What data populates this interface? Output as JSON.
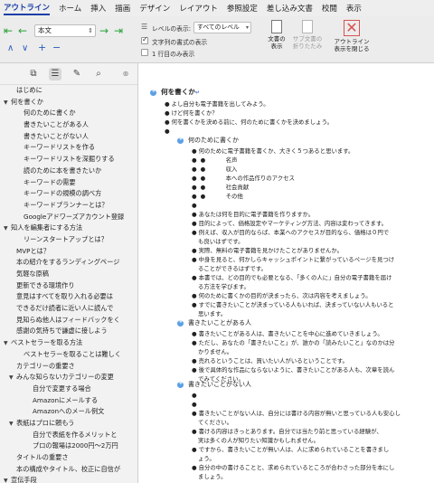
{
  "tabs": [
    "アウトライン",
    "ホーム",
    "挿入",
    "描画",
    "デザイン",
    "レイアウト",
    "参照設定",
    "差し込み文書",
    "校閲",
    "表示"
  ],
  "ribbon": {
    "level_value": "本文",
    "show_level_label": "レベルの表示:",
    "show_level_value": "すべてのレベル",
    "text_format_label": "文字列の書式の表示",
    "first_line_label": "1 行目のみ表示",
    "show_document_label": "文書の\n表示",
    "collapse_subdoc_label": "サブ文書の\n折りたたみ",
    "close_outline_label": "アウトライン\n表示を閉じる"
  },
  "sidebar": {
    "items": [
      {
        "label": "はじめに",
        "indent": 1,
        "tri": ""
      },
      {
        "label": "何を書くか",
        "indent": 0,
        "tri": "▼"
      },
      {
        "label": "何のために書くか",
        "indent": 2,
        "tri": ""
      },
      {
        "label": "書きたいことがある人",
        "indent": 2,
        "tri": ""
      },
      {
        "label": "書きたいことがない人",
        "indent": 2,
        "tri": ""
      },
      {
        "label": "キーワードリストを作る",
        "indent": 2,
        "tri": ""
      },
      {
        "label": "キーワードリストを深掘りする",
        "indent": 2,
        "tri": ""
      },
      {
        "label": "読のために本を書きたいか",
        "indent": 2,
        "tri": ""
      },
      {
        "label": "キーワードの需要",
        "indent": 2,
        "tri": ""
      },
      {
        "label": "キーワードの規模の調べ方",
        "indent": 2,
        "tri": ""
      },
      {
        "label": "キーワードプランナーとは？",
        "indent": 2,
        "tri": ""
      },
      {
        "label": "Googleアドワーズアカウント登録",
        "indent": 2,
        "tri": ""
      },
      {
        "label": "知人を編集者にする方法",
        "indent": 0,
        "tri": "▼"
      },
      {
        "label": "リーンスタートアップとは？",
        "indent": 2,
        "tri": ""
      },
      {
        "label": "MVPとは？",
        "indent": 1,
        "tri": ""
      },
      {
        "label": "本の紹介をするランディングページ",
        "indent": 1,
        "tri": ""
      },
      {
        "label": "気軽な原稿",
        "indent": 1,
        "tri": ""
      },
      {
        "label": "更新できる環境作り",
        "indent": 1,
        "tri": ""
      },
      {
        "label": "意見はすべてを取り入れる必要は",
        "indent": 1,
        "tri": ""
      },
      {
        "label": "できるだけ読者に近い人に読んで",
        "indent": 1,
        "tri": ""
      },
      {
        "label": "見知らぬ他人はフィードバックをく",
        "indent": 1,
        "tri": ""
      },
      {
        "label": "感謝の気持ちで謙虚に接しよう",
        "indent": 1,
        "tri": ""
      },
      {
        "label": "ベストセラーを取る方法",
        "indent": 0,
        "tri": "▼"
      },
      {
        "label": "ベストセラーを取ることは難しく",
        "indent": 2,
        "tri": ""
      },
      {
        "label": "カテゴリーの重要さ",
        "indent": 1,
        "tri": ""
      },
      {
        "label": "みんな知らないカテゴリーの変更",
        "indent": 1,
        "tri": "▼"
      },
      {
        "label": "自分で変更する場合",
        "indent": 3,
        "tri": ""
      },
      {
        "label": "Amazonにメールする",
        "indent": 3,
        "tri": ""
      },
      {
        "label": "Amazonへのメール例文",
        "indent": 3,
        "tri": ""
      },
      {
        "label": "表紙はプロに頼もう",
        "indent": 1,
        "tri": "▼"
      },
      {
        "label": "自分で表紙を作るメリットと",
        "indent": 3,
        "tri": ""
      },
      {
        "label": "プロの報場は2000円〜2万円",
        "indent": 3,
        "tri": ""
      },
      {
        "label": "タイトルの重要さ",
        "indent": 1,
        "tri": ""
      },
      {
        "label": "本の構成やタイトル、校正に自信が",
        "indent": 1,
        "tri": ""
      },
      {
        "label": "宣伝手段",
        "indent": 0,
        "tri": "▼"
      }
    ]
  },
  "doc": {
    "line1": "何を書くか",
    "line2": "よし自分も電子書籍を出してみよう。",
    "line3": "けど何を書くか？",
    "line4": "何を書くかを決める前に、何のために書くかを決めましょう。",
    "h_why": "何のために書くか",
    "why_intro": "何のために電子書籍を書くか、大きく５つあると思います。",
    "purposes": [
      "名声",
      "収入",
      "本への作品作りのアクセス",
      "社会貢献",
      "その他"
    ],
    "p_a1": "あなたは何を目的に電子書籍を作りますか。",
    "p_a2": "目的によって、価格設定やマーケティング方法、内容は変わってきます。",
    "p_a3": "例えば、収入が目的ならば、本業へのアクセスが目的なら、価格は０円で",
    "p_a3b": "も良いはずです。",
    "p_a4": "実際、無料の電子書籍を見かけたことがありませんか。",
    "p_a5": "中身を見ると、何かしらキャッシュポイントに繋がっているページを見つけ",
    "p_a5b": "ることができるはずです。",
    "p_a6": "本書では、どの目的でも必要となる、「多くの人に」自分の電子書籍を届け",
    "p_a6b": "る方法を学びます。",
    "p_a7": "何のために書くかの目的が決まったら、次は内容を考えましょう。",
    "p_a8": "すでに書きたいことが決まっている人もいれば、決まっていない人もいると",
    "p_a8b": "思います。",
    "h_have": "書きたいことがある人",
    "p_b1": "書きたいことがある人は、書きたいことを中心に進めていきましょう。",
    "p_b2": "ただし、あなたの「書きたいこと」が、誰かの「読みたいこと」なのかは分",
    "p_b2b": "かりません。",
    "p_b3": "売れるということは、買いたい人がいるということです。",
    "p_b4": "後で具体的な作品にならないように、書きたいことがある人も、次章を読ん",
    "p_b4b": "でみてください。",
    "h_none": "書きたいことがない人",
    "p_c1": "書きたいことがない人は、自分には書ける内容が無いと思っている人も安心し",
    "p_c1b": "てください。",
    "p_c2": "書ける内容はきっとあります。自分では当たり前と思っている経験が、",
    "p_c2b": "実は多くの人が知りたい知識かもしれません。",
    "p_c3": "ですから、書きたいことが無い人は、人に求められていることを書きまし",
    "p_c3b": "ょう。",
    "p_c4": "自分の中の書けることと、求められているところが合わさった部分を本にし",
    "p_c4b": "ましょう。"
  }
}
